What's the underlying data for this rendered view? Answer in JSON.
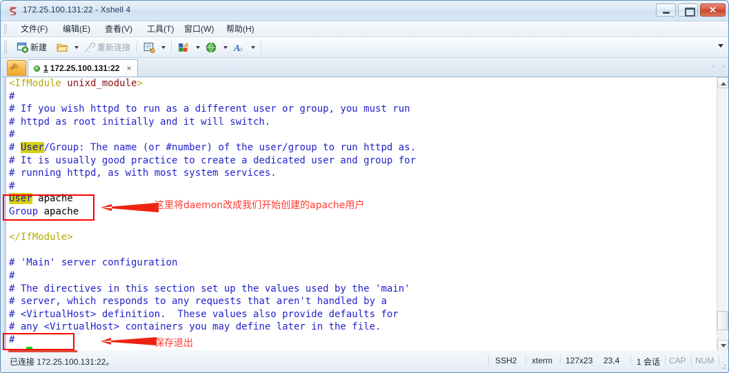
{
  "window": {
    "title": "172.25.100.131:22 - Xshell 4",
    "icon": "xshell-logo-icon",
    "controls": {
      "minimize": "minimize-button",
      "maximize": "restore-button",
      "close": "✕"
    }
  },
  "menubar": {
    "items": [
      {
        "label": "文件(F)",
        "name": "menu-file"
      },
      {
        "label": "编辑(E)",
        "name": "menu-edit"
      },
      {
        "label": "查看(V)",
        "name": "menu-view"
      },
      {
        "label": "工具(T)",
        "name": "menu-tools"
      },
      {
        "label": "窗口(W)",
        "name": "menu-window"
      },
      {
        "label": "帮助(H)",
        "name": "menu-help"
      }
    ]
  },
  "toolbar": {
    "new_label": "新建",
    "reconnect_label": "重新连接",
    "icons": {
      "new": "new-session-icon",
      "open": "open-folder-icon",
      "reconnect": "reconnect-link-icon",
      "properties": "session-properties-icon",
      "layout": "layout-colors-icon",
      "web": "web-globe-icon",
      "font": "font-letter-icon"
    }
  },
  "tabs": {
    "add_label": "+",
    "items": [
      {
        "index": "1",
        "title": "172.25.100.131:22",
        "close": "×",
        "status": "connected"
      }
    ],
    "nav_prev": "‹",
    "nav_next": "›"
  },
  "terminal": {
    "lines": [
      [
        {
          "t": "<IfModule ",
          "c": "tag"
        },
        {
          "t": "unixd_module",
          "c": "str"
        },
        {
          "t": ">",
          "c": "tag"
        }
      ],
      [
        {
          "t": "#",
          "c": "cmt"
        }
      ],
      [
        {
          "t": "# If you wish httpd to run as a different user or group, you must run",
          "c": "cmt"
        }
      ],
      [
        {
          "t": "# httpd as root initially and it will switch.",
          "c": "cmt"
        }
      ],
      [
        {
          "t": "#",
          "c": "cmt"
        }
      ],
      [
        {
          "t": "# ",
          "c": "cmt"
        },
        {
          "t": "User",
          "c": "hl"
        },
        {
          "t": "/Group: The name (or #number) of the user/group to run httpd as.",
          "c": "cmt"
        }
      ],
      [
        {
          "t": "# It is usually good practice to create a dedicated user and group for",
          "c": "cmt"
        }
      ],
      [
        {
          "t": "# running httpd, as with most system services.",
          "c": "cmt"
        }
      ],
      [
        {
          "t": "#",
          "c": "cmt"
        }
      ],
      [
        {
          "t": "User",
          "c": "hl"
        },
        {
          "t": " apache",
          "c": "txt"
        }
      ],
      [
        {
          "t": "Group",
          "c": "key"
        },
        {
          "t": " apache",
          "c": "txt"
        }
      ],
      [
        {
          "t": "",
          "c": "txt"
        }
      ],
      [
        {
          "t": "</IfModule>",
          "c": "tag"
        }
      ],
      [
        {
          "t": "",
          "c": "txt"
        }
      ],
      [
        {
          "t": "# 'Main' server configuration",
          "c": "cmt"
        }
      ],
      [
        {
          "t": "#",
          "c": "cmt"
        }
      ],
      [
        {
          "t": "# The directives in this section set up the values used by the 'main'",
          "c": "cmt"
        }
      ],
      [
        {
          "t": "# server, which responds to any requests that aren't handled by a",
          "c": "cmt"
        }
      ],
      [
        {
          "t": "# <VirtualHost> definition.  These values also provide defaults for",
          "c": "cmt"
        }
      ],
      [
        {
          "t": "# any <VirtualHost> containers you may define later in the file.",
          "c": "cmt"
        }
      ],
      [
        {
          "t": "#",
          "c": "cmt"
        }
      ],
      [
        {
          "t": ":wq",
          "c": "txt"
        },
        {
          "t": " ",
          "c": "cursor"
        }
      ]
    ]
  },
  "annotations": [
    {
      "name": "annotation-user-group",
      "text": "这里将daemon改成我们开始创建的apache用户"
    },
    {
      "name": "annotation-save-quit",
      "text": "保存退出"
    }
  ],
  "statusbar": {
    "connection": "已连接 172.25.100.131:22。",
    "protocol": "SSH2",
    "termtype": "xterm",
    "size": "127x23",
    "cursor": "23,4",
    "sessions": "1 会话",
    "caps": "CAP",
    "num": "NUM"
  },
  "colors": {
    "accent_red": "#ff0000",
    "annotation_red": "#ff3b30",
    "cursor_green": "#00e000",
    "highlight_yellow": "#d7d110",
    "comment_blue": "#2222cc",
    "tag_yellow": "#b5a80b",
    "string_red": "#8a1010"
  }
}
